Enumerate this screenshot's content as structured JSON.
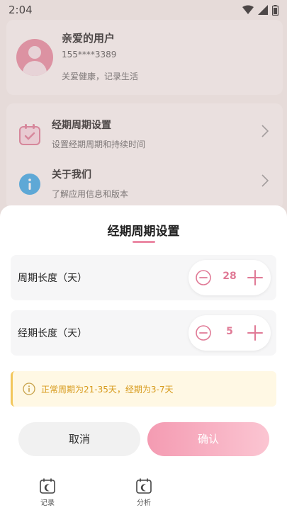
{
  "status_bar": {
    "time": "2:04"
  },
  "profile": {
    "name": "亲爱的用户",
    "phone": "155****3389",
    "slogan": "关爱健康，记录生活"
  },
  "menu": {
    "items": [
      {
        "title": "经期周期设置",
        "subtitle": "设置经期周期和持续时间",
        "icon": "calendar-check-icon"
      },
      {
        "title": "关于我们",
        "subtitle": "了解应用信息和版本",
        "icon": "info-icon"
      }
    ]
  },
  "sheet": {
    "title": "经期周期设置",
    "cycle": {
      "label": "周期长度（天）",
      "value": "28"
    },
    "period": {
      "label": "经期长度（天）",
      "value": "5"
    },
    "tip": "正常周期为21-35天，经期为3-7天",
    "cancel_label": "取消",
    "confirm_label": "确认"
  },
  "tabs": [
    {
      "label": "记录",
      "icon": "calendar-icon"
    },
    {
      "label": "分析",
      "icon": "calendar-icon"
    }
  ],
  "colors": {
    "accent": "#e07a96",
    "accent_light": "#eb8aa5",
    "tip_text": "#d79a1b",
    "tip_bg": "#fff8e4",
    "info_blue": "#3aa8e8"
  }
}
